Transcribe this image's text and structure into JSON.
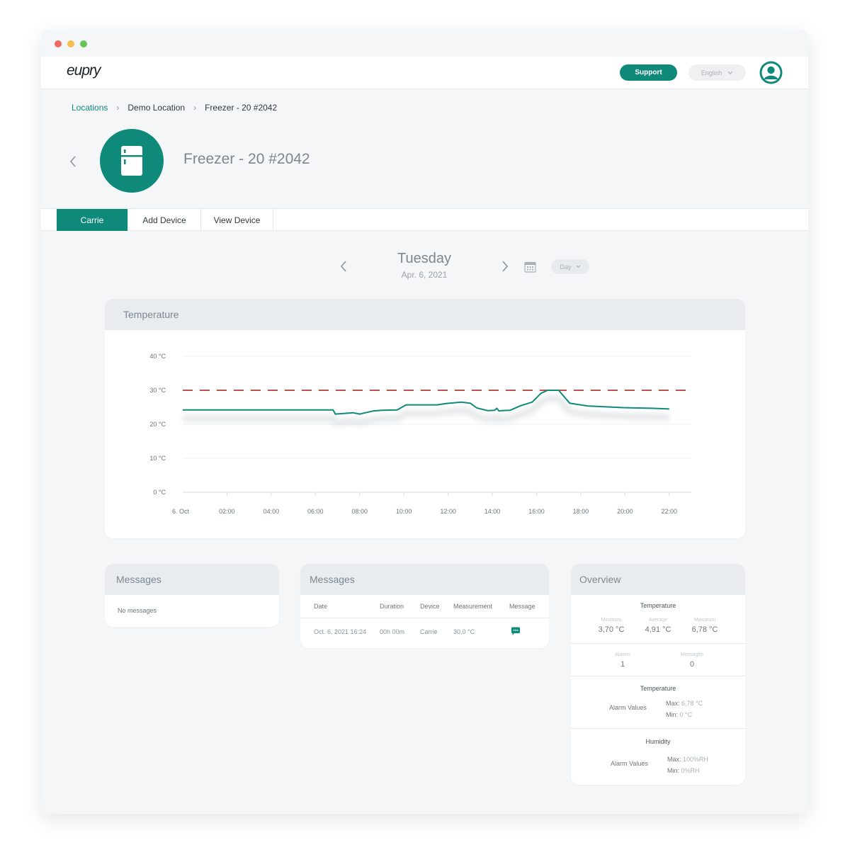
{
  "app": {
    "logo_text": "eupry"
  },
  "header": {
    "support_label": "Support",
    "language_label": "English",
    "language_icon": "chevron-down-icon",
    "avatar_icon": "user-icon"
  },
  "breadcrumb": {
    "items": [
      "Locations",
      "Demo Location",
      "Freezer - 20 #2042"
    ]
  },
  "device": {
    "title": "Freezer - 20 #2042",
    "icon": "fridge-icon"
  },
  "tabs": [
    {
      "label": "Carrie",
      "active": true
    },
    {
      "label": "Add Device",
      "active": false
    },
    {
      "label": "View Device",
      "active": false
    }
  ],
  "date_nav": {
    "day": "Tuesday",
    "date": "Apr. 6, 2021",
    "range_label": "Day"
  },
  "temperature_card": {
    "title": "Temperature"
  },
  "chart_data": {
    "type": "line",
    "title": "Temperature",
    "y_ticks": [
      "40 °C",
      "30 °C",
      "20 °C",
      "10 °C",
      "0 °C"
    ],
    "x_ticks": [
      "6. Oct",
      "02:00",
      "04:00",
      "06:00",
      "08:00",
      "10:00",
      "12:00",
      "14:00",
      "16:00",
      "18:00",
      "20:00",
      "22:00"
    ],
    "ylim": [
      0,
      40
    ],
    "xlim": [
      0,
      23
    ],
    "threshold": {
      "value": 30,
      "style": "dashed",
      "color": "#c0504d"
    },
    "series": [
      {
        "color": "#0f8a7a",
        "x": [
          0,
          6.8,
          6.9,
          7.7,
          8.0,
          8.6,
          9.0,
          9.7,
          10.1,
          11.5,
          11.9,
          12.6,
          13.0,
          13.3,
          13.8,
          14.1,
          14.2,
          14.3,
          14.4,
          14.8,
          15.3,
          15.8,
          16.2,
          16.5,
          17.0,
          17.5,
          18.3,
          19.9,
          21.2,
          22.0
        ],
        "values": [
          24.2,
          24.2,
          23.0,
          23.4,
          23.0,
          23.9,
          24.1,
          24.2,
          25.7,
          25.7,
          26.1,
          26.5,
          26.2,
          24.8,
          24.0,
          24.1,
          24.7,
          23.9,
          24.0,
          24.1,
          25.5,
          26.5,
          29.1,
          30.0,
          30.0,
          26.2,
          25.4,
          24.9,
          24.7,
          24.5
        ]
      }
    ],
    "grid": true
  },
  "messages_left": {
    "title": "Messages",
    "empty_text": "No messages"
  },
  "messages_table": {
    "title": "Messages",
    "columns": [
      "Date",
      "Duration",
      "Device",
      "Measurement",
      "Message"
    ],
    "rows": [
      {
        "date": "Oct. 6, 2021 16:24",
        "duration": "00h 00m",
        "device": "Carrie",
        "measurement": "30,0 °C",
        "message_icon": "chat-bubble-icon"
      }
    ]
  },
  "overview": {
    "title": "Overview",
    "temperature_title": "Temperature",
    "min_label": "Minimum",
    "min_value": "3,70 °C",
    "avg_label": "Average",
    "avg_value": "4,91 °C",
    "max_label": "Maximum",
    "max_value": "6,78 °C",
    "alarms_label": "Alarms",
    "alarms_value": "1",
    "messages_label": "Messages",
    "messages_value": "0",
    "temp_alarm_title": "Temperature",
    "temp_alarm_label": "Alarm Values",
    "temp_max_prefix": "Max:",
    "temp_max": "6,78 °C",
    "temp_min_prefix": "Min:",
    "temp_min": "0 °C",
    "hum_alarm_title": "Humidity",
    "hum_alarm_label": "Alarm Values",
    "hum_max_prefix": "Max:",
    "hum_max": "100%RH",
    "hum_min_prefix": "Min:",
    "hum_min": "0%RH"
  },
  "colors": {
    "accent": "#0f8a7a",
    "threshold": "#c0504d",
    "background": "#f4f6f8"
  }
}
